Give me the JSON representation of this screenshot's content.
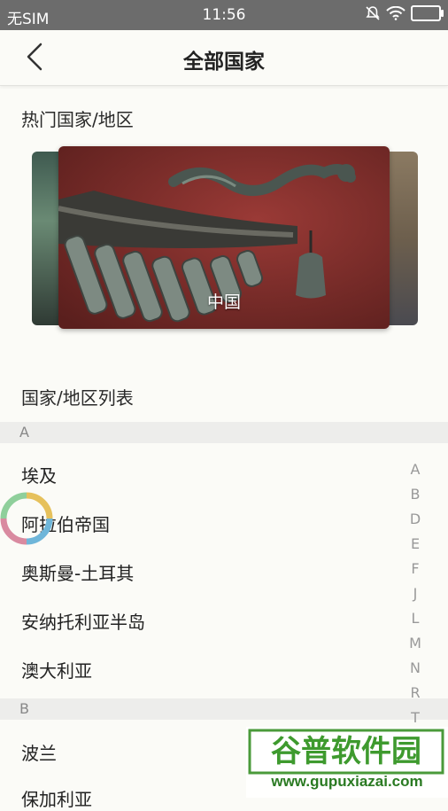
{
  "status_bar": {
    "carrier": "无SIM",
    "time": "11:56"
  },
  "header": {
    "title": "全部国家"
  },
  "hot": {
    "title": "热门国家/地区",
    "featured_label": "中国"
  },
  "list": {
    "title": "国家/地区列表",
    "sections": [
      {
        "letter": "A",
        "items": [
          "埃及",
          "阿拉伯帝国",
          "奥斯曼-土耳其",
          "安纳托利亚半岛",
          "澳大利亚"
        ]
      },
      {
        "letter": "B",
        "items": [
          "波兰",
          "保加利亚"
        ]
      }
    ]
  },
  "index_letters": [
    "A",
    "B",
    "D",
    "E",
    "F",
    "J",
    "L",
    "M",
    "N",
    "R",
    "T"
  ],
  "watermark": {
    "brand": "谷普软件园",
    "url": "www.gupuxiazai.com"
  }
}
